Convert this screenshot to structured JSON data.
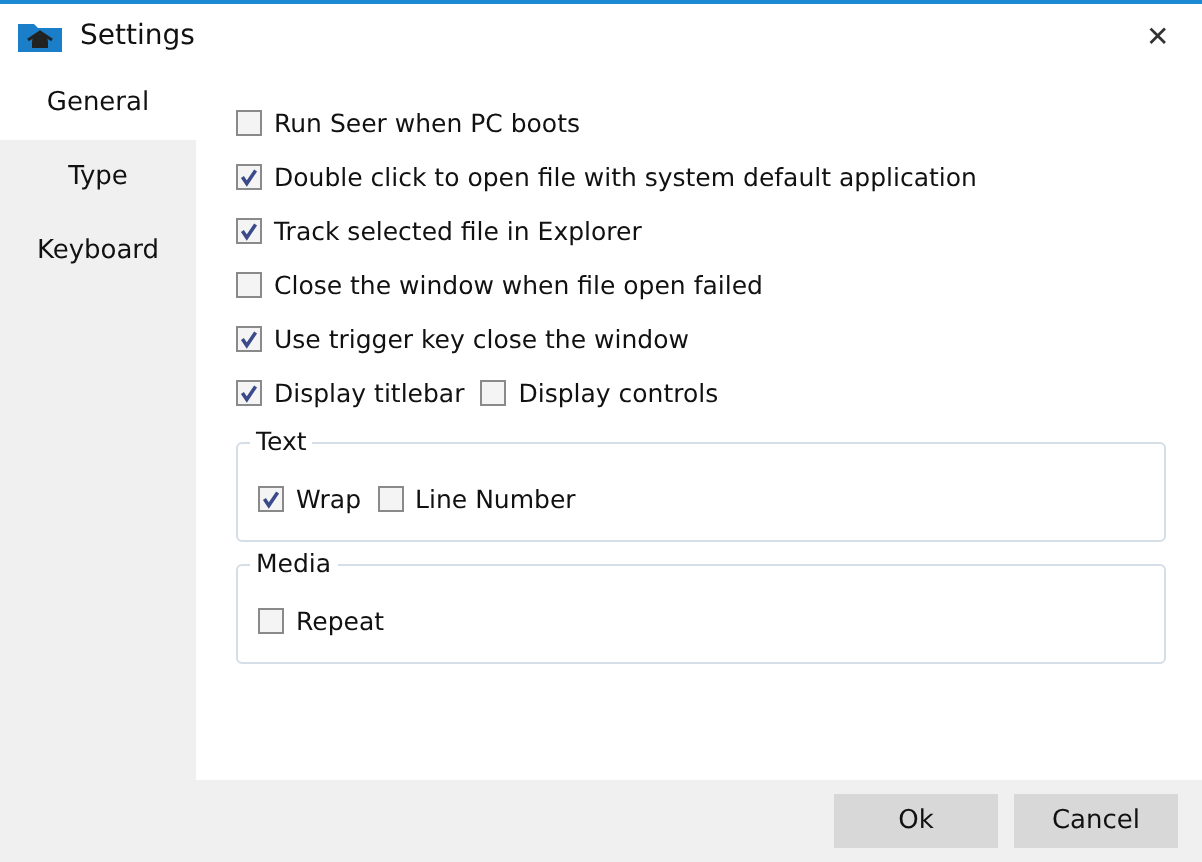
{
  "window": {
    "title": "Settings",
    "close": "✕"
  },
  "tabs": [
    {
      "label": "General",
      "selected": true
    },
    {
      "label": "Type",
      "selected": false
    },
    {
      "label": "Keyboard",
      "selected": false
    }
  ],
  "options": [
    {
      "label": "Run Seer when PC boots",
      "checked": false
    },
    {
      "label": "Double click to open file with system default application",
      "checked": true
    },
    {
      "label": "Track selected file in Explorer",
      "checked": true
    },
    {
      "label": "Close the window when file open failed",
      "checked": false
    },
    {
      "label": "Use trigger key close the window",
      "checked": true
    }
  ],
  "display_options": [
    {
      "label": "Display titlebar",
      "checked": true
    },
    {
      "label": "Display controls",
      "checked": false
    }
  ],
  "groups": [
    {
      "title": "Text",
      "options": [
        {
          "label": "Wrap",
          "checked": true
        },
        {
          "label": "Line Number",
          "checked": false
        }
      ]
    },
    {
      "title": "Media",
      "options": [
        {
          "label": "Repeat",
          "checked": false
        }
      ]
    }
  ],
  "buttons": [
    "Ok",
    "Cancel"
  ]
}
